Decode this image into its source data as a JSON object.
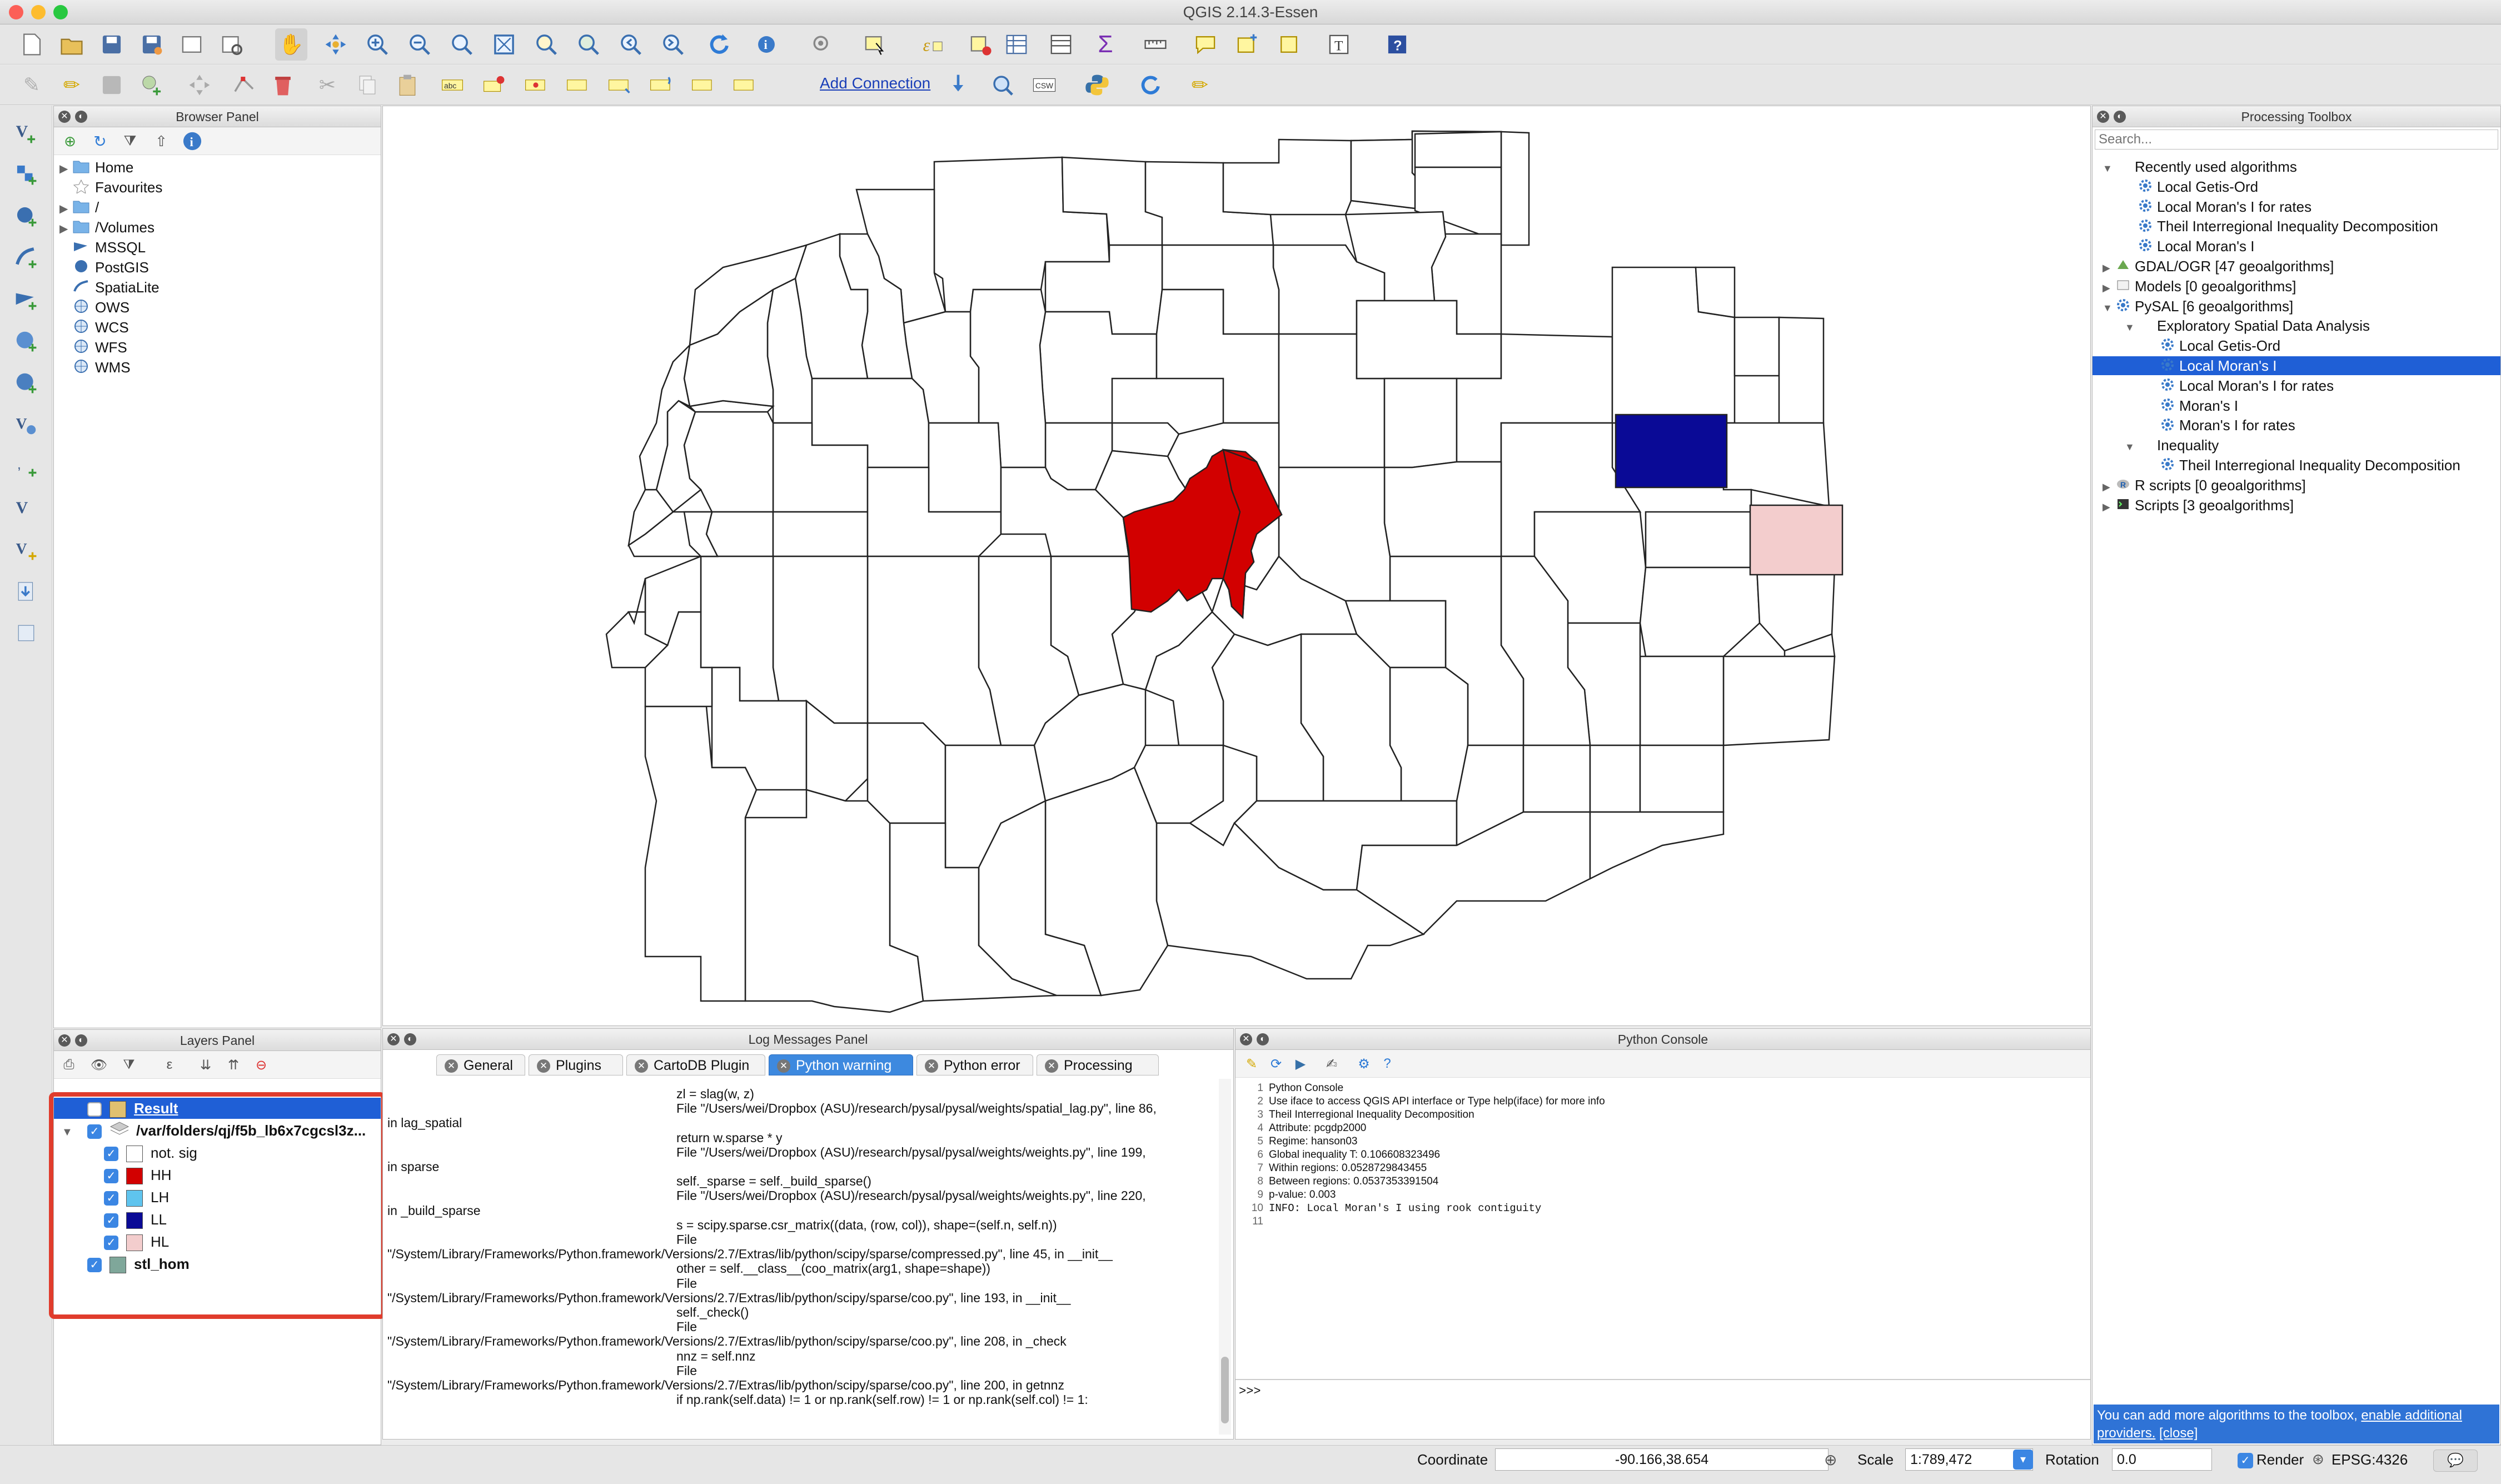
{
  "window": {
    "title": "QGIS 2.14.3-Essen"
  },
  "toolbar2": {
    "add_connection": "Add Connection",
    "csw": "CSW"
  },
  "browser": {
    "title": "Browser Panel",
    "items": [
      {
        "label": "Home",
        "icon": "folder-icon",
        "expandable": true
      },
      {
        "label": "Favourites",
        "icon": "star-icon",
        "expandable": false
      },
      {
        "label": "/",
        "icon": "folder-icon",
        "expandable": true
      },
      {
        "label": "/Volumes",
        "icon": "folder-icon",
        "expandable": true
      },
      {
        "label": "MSSQL",
        "icon": "mssql-icon",
        "expandable": false
      },
      {
        "label": "PostGIS",
        "icon": "postgis-icon",
        "expandable": false
      },
      {
        "label": "SpatiaLite",
        "icon": "spatialite-icon",
        "expandable": false
      },
      {
        "label": "OWS",
        "icon": "globe-icon",
        "expandable": false
      },
      {
        "label": "WCS",
        "icon": "globe-icon",
        "expandable": false
      },
      {
        "label": "WFS",
        "icon": "globe-icon",
        "expandable": false
      },
      {
        "label": "WMS",
        "icon": "globe-icon",
        "expandable": false
      }
    ]
  },
  "processing": {
    "title": "Processing Toolbox",
    "search_placeholder": "Search...",
    "items": [
      {
        "label": "Recently used algorithms",
        "level": 0,
        "arrow": "▼",
        "icon": "",
        "selected": false
      },
      {
        "label": "Local Getis-Ord",
        "level": 1,
        "arrow": "",
        "icon": "gear",
        "selected": false
      },
      {
        "label": "Local Moran's I for rates",
        "level": 1,
        "arrow": "",
        "icon": "gear",
        "selected": false
      },
      {
        "label": "Theil Interregional Inequality Decomposition",
        "level": 1,
        "arrow": "",
        "icon": "gear",
        "selected": false
      },
      {
        "label": "Local Moran's I",
        "level": 1,
        "arrow": "",
        "icon": "gear",
        "selected": false
      },
      {
        "label": "GDAL/OGR [47 geoalgorithms]",
        "level": 0,
        "arrow": "▶",
        "icon": "gdal",
        "selected": false
      },
      {
        "label": "Models [0 geoalgorithms]",
        "level": 0,
        "arrow": "▶",
        "icon": "models",
        "selected": false
      },
      {
        "label": "PySAL [6 geoalgorithms]",
        "level": 0,
        "arrow": "▼",
        "icon": "gear",
        "selected": false
      },
      {
        "label": "Exploratory Spatial Data Analysis",
        "level": 1,
        "arrow": "▼",
        "icon": "",
        "selected": false
      },
      {
        "label": "Local Getis-Ord",
        "level": 2,
        "arrow": "",
        "icon": "gear",
        "selected": false
      },
      {
        "label": "Local Moran's I",
        "level": 2,
        "arrow": "",
        "icon": "gear",
        "selected": true
      },
      {
        "label": "Local Moran's I for rates",
        "level": 2,
        "arrow": "",
        "icon": "gear",
        "selected": false
      },
      {
        "label": "Moran's I",
        "level": 2,
        "arrow": "",
        "icon": "gear",
        "selected": false
      },
      {
        "label": "Moran's I for rates",
        "level": 2,
        "arrow": "",
        "icon": "gear",
        "selected": false
      },
      {
        "label": "Inequality",
        "level": 1,
        "arrow": "▼",
        "icon": "",
        "selected": false
      },
      {
        "label": "Theil Interregional Inequality Decomposition",
        "level": 2,
        "arrow": "",
        "icon": "gear",
        "selected": false
      },
      {
        "label": "R scripts [0 geoalgorithms]",
        "level": 0,
        "arrow": "▶",
        "icon": "r",
        "selected": false
      },
      {
        "label": "Scripts [3 geoalgorithms]",
        "level": 0,
        "arrow": "▶",
        "icon": "script",
        "selected": false
      }
    ],
    "footer_text": "You can add more algorithms to the toolbox,",
    "footer_link1": "enable additional providers.",
    "footer_link2": "[close]"
  },
  "layers": {
    "title": "Layers Panel",
    "items": [
      {
        "label": "Result",
        "checked": false,
        "swatch": "#e0c070",
        "level": 0,
        "bold": true,
        "selected": true,
        "arrow": ""
      },
      {
        "label": "/var/folders/qj/f5b_lb6x7cgcsl3z...",
        "checked": true,
        "swatch": "",
        "level": 0,
        "bold": true,
        "selected": false,
        "arrow": "▼"
      },
      {
        "label": "not. sig",
        "checked": true,
        "swatch": "#ffffff",
        "level": 1,
        "bold": false,
        "selected": false,
        "arrow": ""
      },
      {
        "label": "HH",
        "checked": true,
        "swatch": "#d20000",
        "level": 1,
        "bold": false,
        "selected": false,
        "arrow": ""
      },
      {
        "label": "LH",
        "checked": true,
        "swatch": "#5fc4ee",
        "level": 1,
        "bold": false,
        "selected": false,
        "arrow": ""
      },
      {
        "label": "LL",
        "checked": true,
        "swatch": "#0a0a96",
        "level": 1,
        "bold": false,
        "selected": false,
        "arrow": ""
      },
      {
        "label": "HL",
        "checked": true,
        "swatch": "#f3cdcd",
        "level": 1,
        "bold": false,
        "selected": false,
        "arrow": ""
      },
      {
        "label": "stl_hom",
        "checked": true,
        "swatch": "#7fa79a",
        "level": 0,
        "bold": true,
        "selected": false,
        "arrow": ""
      }
    ]
  },
  "log": {
    "title": "Log Messages Panel",
    "tabs": [
      "General",
      "Plugins",
      "CartoDB Plugin",
      "Python warning",
      "Python error",
      "Processing"
    ],
    "active_tab": 3,
    "lines": [
      {
        "indent": true,
        "text": "zl = slag(w, z)"
      },
      {
        "indent": true,
        "text": "File \"/Users/wei/Dropbox (ASU)/research/pysal/pysal/weights/spatial_lag.py\", line 86,"
      },
      {
        "indent": false,
        "text": "in lag_spatial"
      },
      {
        "indent": true,
        "text": "return w.sparse * y"
      },
      {
        "indent": true,
        "text": "File \"/Users/wei/Dropbox (ASU)/research/pysal/pysal/weights/weights.py\", line 199,"
      },
      {
        "indent": false,
        "text": "in sparse"
      },
      {
        "indent": true,
        "text": "self._sparse = self._build_sparse()"
      },
      {
        "indent": true,
        "text": "File \"/Users/wei/Dropbox (ASU)/research/pysal/pysal/weights/weights.py\", line 220,"
      },
      {
        "indent": false,
        "text": "in _build_sparse"
      },
      {
        "indent": true,
        "text": "s = scipy.sparse.csr_matrix((data, (row, col)), shape=(self.n, self.n))"
      },
      {
        "indent": true,
        "text": "File"
      },
      {
        "indent": false,
        "text": "\"/System/Library/Frameworks/Python.framework/Versions/2.7/Extras/lib/python/scipy/sparse/compressed.py\", line 45, in __init__"
      },
      {
        "indent": true,
        "text": "other = self.__class__(coo_matrix(arg1, shape=shape))"
      },
      {
        "indent": true,
        "text": "File"
      },
      {
        "indent": false,
        "text": "\"/System/Library/Frameworks/Python.framework/Versions/2.7/Extras/lib/python/scipy/sparse/coo.py\", line 193, in __init__"
      },
      {
        "indent": true,
        "text": "self._check()"
      },
      {
        "indent": true,
        "text": "File"
      },
      {
        "indent": false,
        "text": "\"/System/Library/Frameworks/Python.framework/Versions/2.7/Extras/lib/python/scipy/sparse/coo.py\", line 208, in _check"
      },
      {
        "indent": true,
        "text": "nnz = self.nnz"
      },
      {
        "indent": true,
        "text": "File"
      },
      {
        "indent": false,
        "text": "\"/System/Library/Frameworks/Python.framework/Versions/2.7/Extras/lib/python/scipy/sparse/coo.py\", line 200, in getnnz"
      },
      {
        "indent": true,
        "text": "if np.rank(self.data) != 1 or np.rank(self.row) != 1 or np.rank(self.col) != 1:"
      }
    ]
  },
  "python": {
    "title": "Python Console",
    "prompt": ">>>",
    "lines": [
      {
        "n": "1",
        "text": "Python Console",
        "color": "#111"
      },
      {
        "n": "2",
        "text": "Use iface to access QGIS API interface or Type help(iface) for more info",
        "color": "#111"
      },
      {
        "n": "3",
        "text": "Theil Interregional Inequality Decomposition",
        "color": "#111"
      },
      {
        "n": "4",
        "text": "Attribute:  pcgdp2000",
        "color": "#111"
      },
      {
        "n": "5",
        "text": "Regime:  hanson03",
        "color": "#111"
      },
      {
        "n": "6",
        "text": "Global inequality T:  0.106608323496",
        "color": "#111"
      },
      {
        "n": "7",
        "text": "Within regions:  0.0528729843455",
        "color": "#111"
      },
      {
        "n": "8",
        "text": "Between regions:  0.0537353391504",
        "color": "#111"
      },
      {
        "n": "9",
        "text": "p-value:  0.003",
        "color": "#111"
      },
      {
        "n": "10",
        "text": "INFO: Local Moran's I using rook contiguity",
        "color": "#111"
      },
      {
        "n": "11",
        "text": "",
        "color": "#111"
      }
    ]
  },
  "status": {
    "coordinate_label": "Coordinate",
    "coordinate_value": "-90.166,38.654",
    "scale_label": "Scale",
    "scale_value": "1:789,472",
    "rotation_label": "Rotation",
    "rotation_value": "0.0",
    "render_label": "Render",
    "crs": "EPSG:4326"
  },
  "colors": {
    "hh": "#d20000",
    "ll": "#0a0a96",
    "hl": "#f3cdcd",
    "selection": "#1f5fd6",
    "highlight_box": "#e03c2c"
  }
}
